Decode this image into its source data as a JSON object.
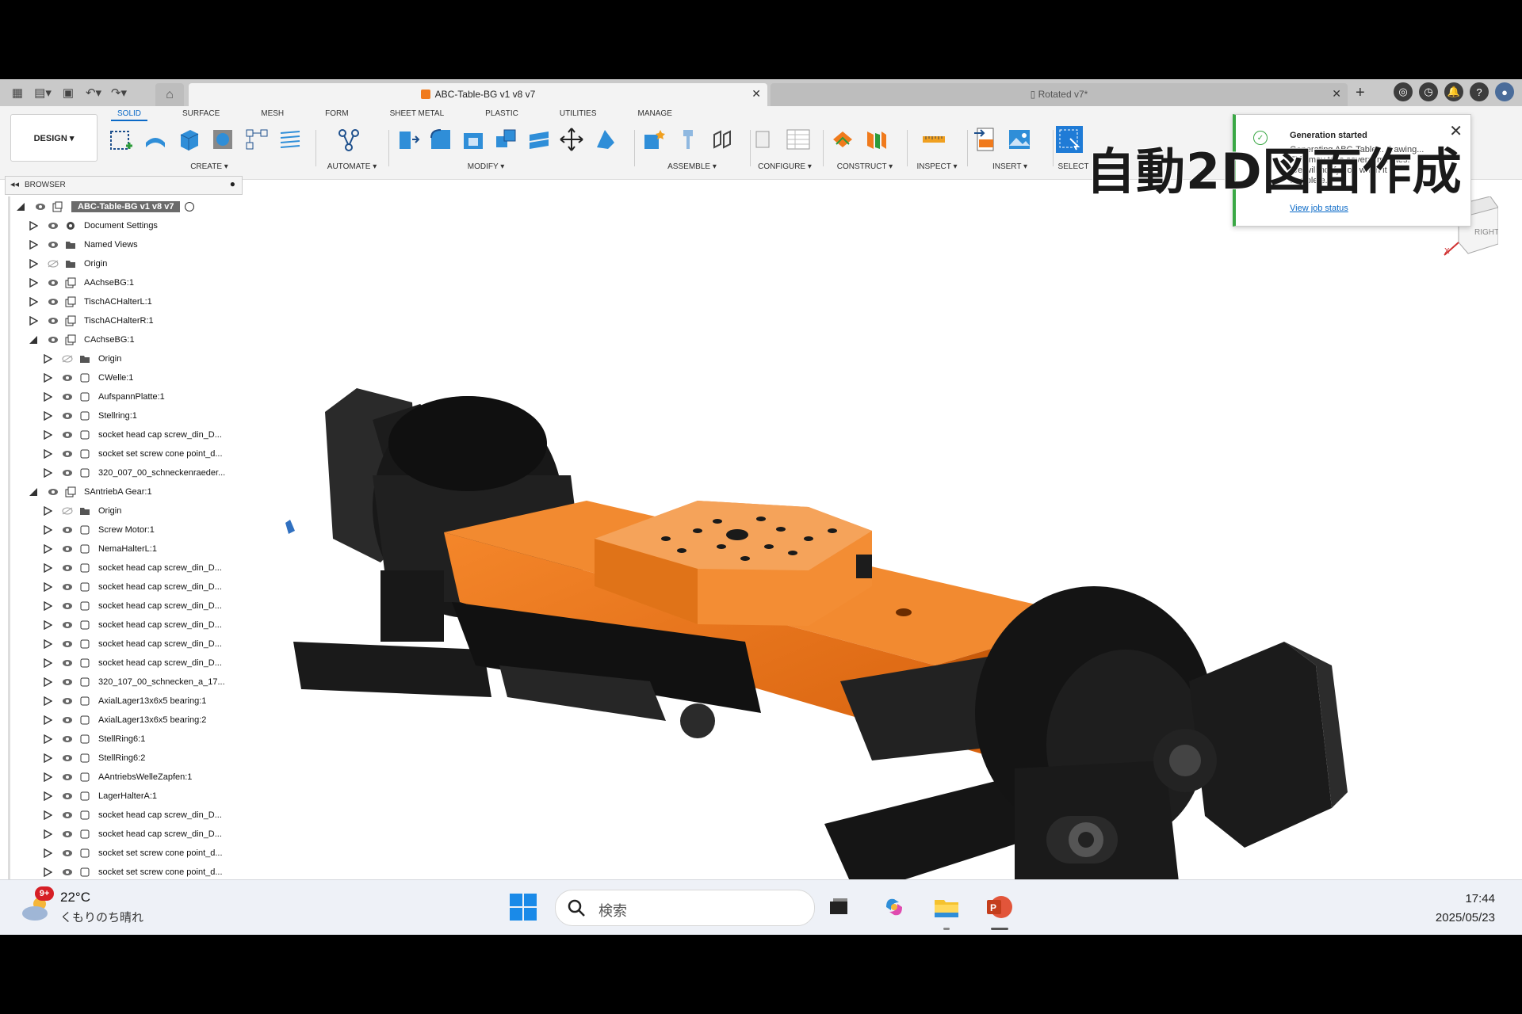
{
  "window": {
    "tab_active_title": "ABC-Table-BG v1 v8 v7",
    "tab_inactive_title": "Rotated v7*",
    "tab_close_glyph": "✕",
    "add_tab_glyph": "+"
  },
  "toolbar": {
    "design_label": "DESIGN ▾",
    "workspace_tabs": [
      "SOLID",
      "SURFACE",
      "MESH",
      "FORM",
      "SHEET METAL",
      "PLASTIC",
      "UTILITIES",
      "MANAGE"
    ],
    "active_tab": "SOLID",
    "groups": {
      "create": "CREATE ▾",
      "automate": "AUTOMATE ▾",
      "modify": "MODIFY ▾",
      "assemble": "ASSEMBLE ▾",
      "configure": "CONFIGURE ▾",
      "construct": "CONSTRUCT ▾",
      "inspect": "INSPECT ▾",
      "insert": "INSERT ▾",
      "select": "SELECT"
    }
  },
  "browser": {
    "title": "BROWSER",
    "root": "ABC-Table-BG v1 v8 v7",
    "items": [
      {
        "label": "Document Settings",
        "level": 1,
        "icon": "gear-icon"
      },
      {
        "label": "Named Views",
        "level": 1,
        "icon": "folder-icon"
      },
      {
        "label": "Origin",
        "level": 1,
        "icon": "folder-icon"
      },
      {
        "label": "AAchseBG:1",
        "level": 1,
        "icon": "component-icon"
      },
      {
        "label": "TischACHalterL:1",
        "level": 1,
        "icon": "component-icon"
      },
      {
        "label": "TischACHalterR:1",
        "level": 1,
        "icon": "component-icon"
      },
      {
        "label": "CAchseBG:1",
        "level": 1,
        "icon": "component-icon",
        "expanded": true
      },
      {
        "label": "Origin",
        "level": 2,
        "icon": "folder-icon"
      },
      {
        "label": "CWelle:1",
        "level": 2,
        "icon": "body-icon"
      },
      {
        "label": "AufspannPlatte:1",
        "level": 2,
        "icon": "body-icon"
      },
      {
        "label": "Stellring:1",
        "level": 2,
        "icon": "body-icon"
      },
      {
        "label": "socket head cap screw_din_D...",
        "level": 2,
        "icon": "body-icon"
      },
      {
        "label": "socket set screw cone point_d...",
        "level": 2,
        "icon": "body-icon"
      },
      {
        "label": "320_007_00_schneckenraeder...",
        "level": 2,
        "icon": "body-icon"
      },
      {
        "label": "SAntriebA Gear:1",
        "level": 1,
        "icon": "component-icon",
        "expanded": true
      },
      {
        "label": "Origin",
        "level": 2,
        "icon": "folder-icon"
      },
      {
        "label": "Screw Motor:1",
        "level": 2,
        "icon": "body-icon"
      },
      {
        "label": "NemaHalterL:1",
        "level": 2,
        "icon": "body-icon"
      },
      {
        "label": "socket head cap screw_din_D...",
        "level": 2,
        "icon": "body-icon"
      },
      {
        "label": "socket head cap screw_din_D...",
        "level": 2,
        "icon": "body-icon"
      },
      {
        "label": "socket head cap screw_din_D...",
        "level": 2,
        "icon": "body-icon"
      },
      {
        "label": "socket head cap screw_din_D...",
        "level": 2,
        "icon": "body-icon"
      },
      {
        "label": "socket head cap screw_din_D...",
        "level": 2,
        "icon": "body-icon"
      },
      {
        "label": "socket head cap screw_din_D...",
        "level": 2,
        "icon": "body-icon"
      },
      {
        "label": "320_107_00_schnecken_a_17...",
        "level": 2,
        "icon": "body-icon"
      },
      {
        "label": "AxialLager13x6x5 bearing:1",
        "level": 2,
        "icon": "body-icon"
      },
      {
        "label": "AxialLager13x6x5 bearing:2",
        "level": 2,
        "icon": "body-icon"
      },
      {
        "label": "StellRing6:1",
        "level": 2,
        "icon": "body-icon"
      },
      {
        "label": "StellRing6:2",
        "level": 2,
        "icon": "body-icon"
      },
      {
        "label": "AAntriebsWelleZapfen:1",
        "level": 2,
        "icon": "body-icon"
      },
      {
        "label": "LagerHalterA:1",
        "level": 2,
        "icon": "body-icon"
      },
      {
        "label": "socket head cap screw_din_D...",
        "level": 2,
        "icon": "body-icon"
      },
      {
        "label": "socket head cap screw_din_D...",
        "level": 2,
        "icon": "body-icon"
      },
      {
        "label": "socket set screw cone point_d...",
        "level": 2,
        "icon": "body-icon"
      },
      {
        "label": "socket set screw cone point_d...",
        "level": 2,
        "icon": "body-icon"
      }
    ]
  },
  "notification": {
    "title": "Generation started",
    "body": "Generating ABC-Table... drawing... This may take several minutes. We will notify you when it is complete.",
    "link": "View job status"
  },
  "overlay_caption": "自動2D図面作成",
  "viewcube": {
    "face": "RIGHT",
    "axis": "X"
  },
  "taskbar": {
    "badge": "9+",
    "temperature": "22°C",
    "weather": "くもりのち晴れ",
    "search_placeholder": "検索",
    "time": "17:44",
    "date": "2025/05/23"
  },
  "colors": {
    "accent": "#0a69c7",
    "part_orange": "#f07a1c",
    "part_black": "#1a1a1a",
    "notify_green": "#3aa845"
  }
}
